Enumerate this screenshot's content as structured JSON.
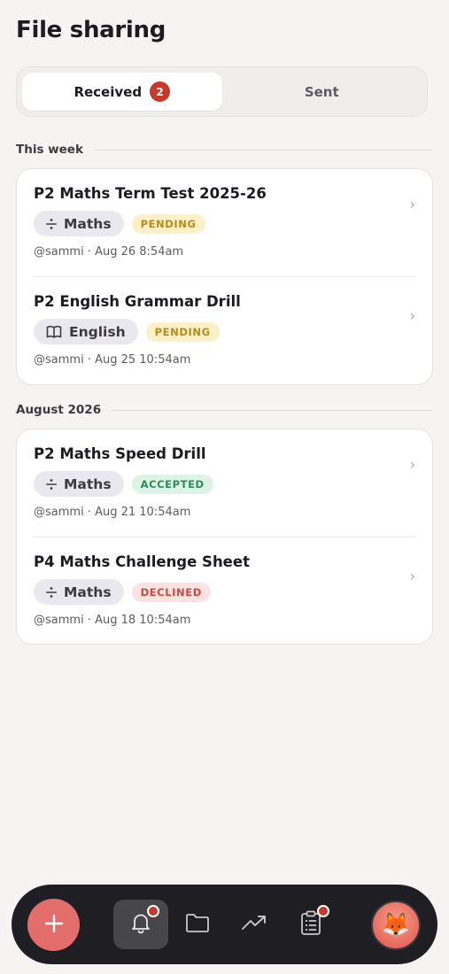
{
  "header": {
    "title": "File sharing"
  },
  "tabs": [
    {
      "label": "Received",
      "badge": "2",
      "active": true
    },
    {
      "label": "Sent",
      "active": false
    }
  ],
  "sections": [
    {
      "title": "This week",
      "items": [
        {
          "title": "P2 Maths Term Test 2025-26",
          "subject": "Maths",
          "subject_icon": "divide-icon",
          "status": "PENDING",
          "meta": "@sammi · Aug 26 8:54am"
        },
        {
          "title": "P2 English Grammar Drill",
          "subject": "English",
          "subject_icon": "book-icon",
          "status": "PENDING",
          "meta": "@sammi · Aug 25 10:54am"
        }
      ]
    },
    {
      "title": "August 2026",
      "items": [
        {
          "title": "P2 Maths Speed Drill",
          "subject": "Maths",
          "subject_icon": "divide-icon",
          "status": "ACCEPTED",
          "meta": "@sammi · Aug 21 10:54am"
        },
        {
          "title": "P4 Maths Challenge Sheet",
          "subject": "Maths",
          "subject_icon": "divide-icon",
          "status": "DECLINED",
          "meta": "@sammi · Aug 18 10:54am"
        }
      ]
    }
  ],
  "status_colors": {
    "PENDING": {
      "bg": "#fbf0c8",
      "fg": "#b88a17"
    },
    "ACCEPTED": {
      "bg": "#dcf3e6",
      "fg": "#2d8c5b"
    },
    "DECLINED": {
      "bg": "#fbe3e1",
      "fg": "#c94a3f"
    }
  },
  "bottom_nav": {
    "fab_icon": "plus-icon",
    "items": [
      {
        "icon": "bell-icon",
        "active": true,
        "notification": true
      },
      {
        "icon": "folder-icon",
        "active": false,
        "notification": false
      },
      {
        "icon": "trending-up-icon",
        "active": false,
        "notification": false
      },
      {
        "icon": "clipboard-list-icon",
        "active": false,
        "notification": true
      }
    ],
    "avatar": "🦊"
  },
  "colors": {
    "accent": "#c63a2d",
    "fab": "#e26d6a",
    "nav_bg": "#1f1e23"
  }
}
